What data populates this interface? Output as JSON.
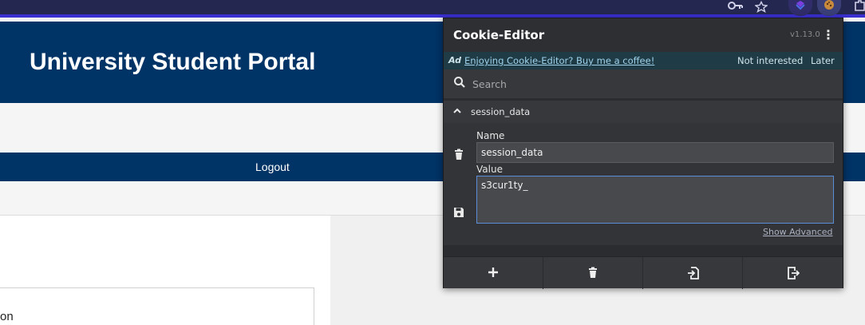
{
  "browser": {
    "toolbar_icons": [
      "key-icon",
      "star-icon",
      "extension-shield-icon",
      "cookie-icon",
      "puzzle-icon"
    ]
  },
  "page": {
    "title": "University Student Portal",
    "nav": {
      "logout_label": "Logout"
    },
    "content_text": "on",
    "colors": {
      "header_bg": "#003366",
      "nav_bg": "#003366"
    }
  },
  "popup": {
    "title": "Cookie-Editor",
    "version": "v1.13.0",
    "ad": {
      "tag": "Ad",
      "link": "Enjoying Cookie-Editor? Buy me a coffee!",
      "not_interested": "Not interested",
      "later": "Later"
    },
    "search": {
      "placeholder": "Search",
      "value": ""
    },
    "cookie": {
      "name": "session_data",
      "name_label": "Name",
      "name_value": "session_data",
      "value_label": "Value",
      "value_value": "s3cur1ty_",
      "show_advanced": "Show Advanced"
    },
    "footer": {
      "buttons": [
        "add-icon",
        "delete-all-icon",
        "import-icon",
        "export-icon"
      ]
    },
    "colors": {
      "bg": "#2b2c2f",
      "ad_bg": "#1f3b46",
      "focus_border": "#5b8cd6"
    }
  }
}
